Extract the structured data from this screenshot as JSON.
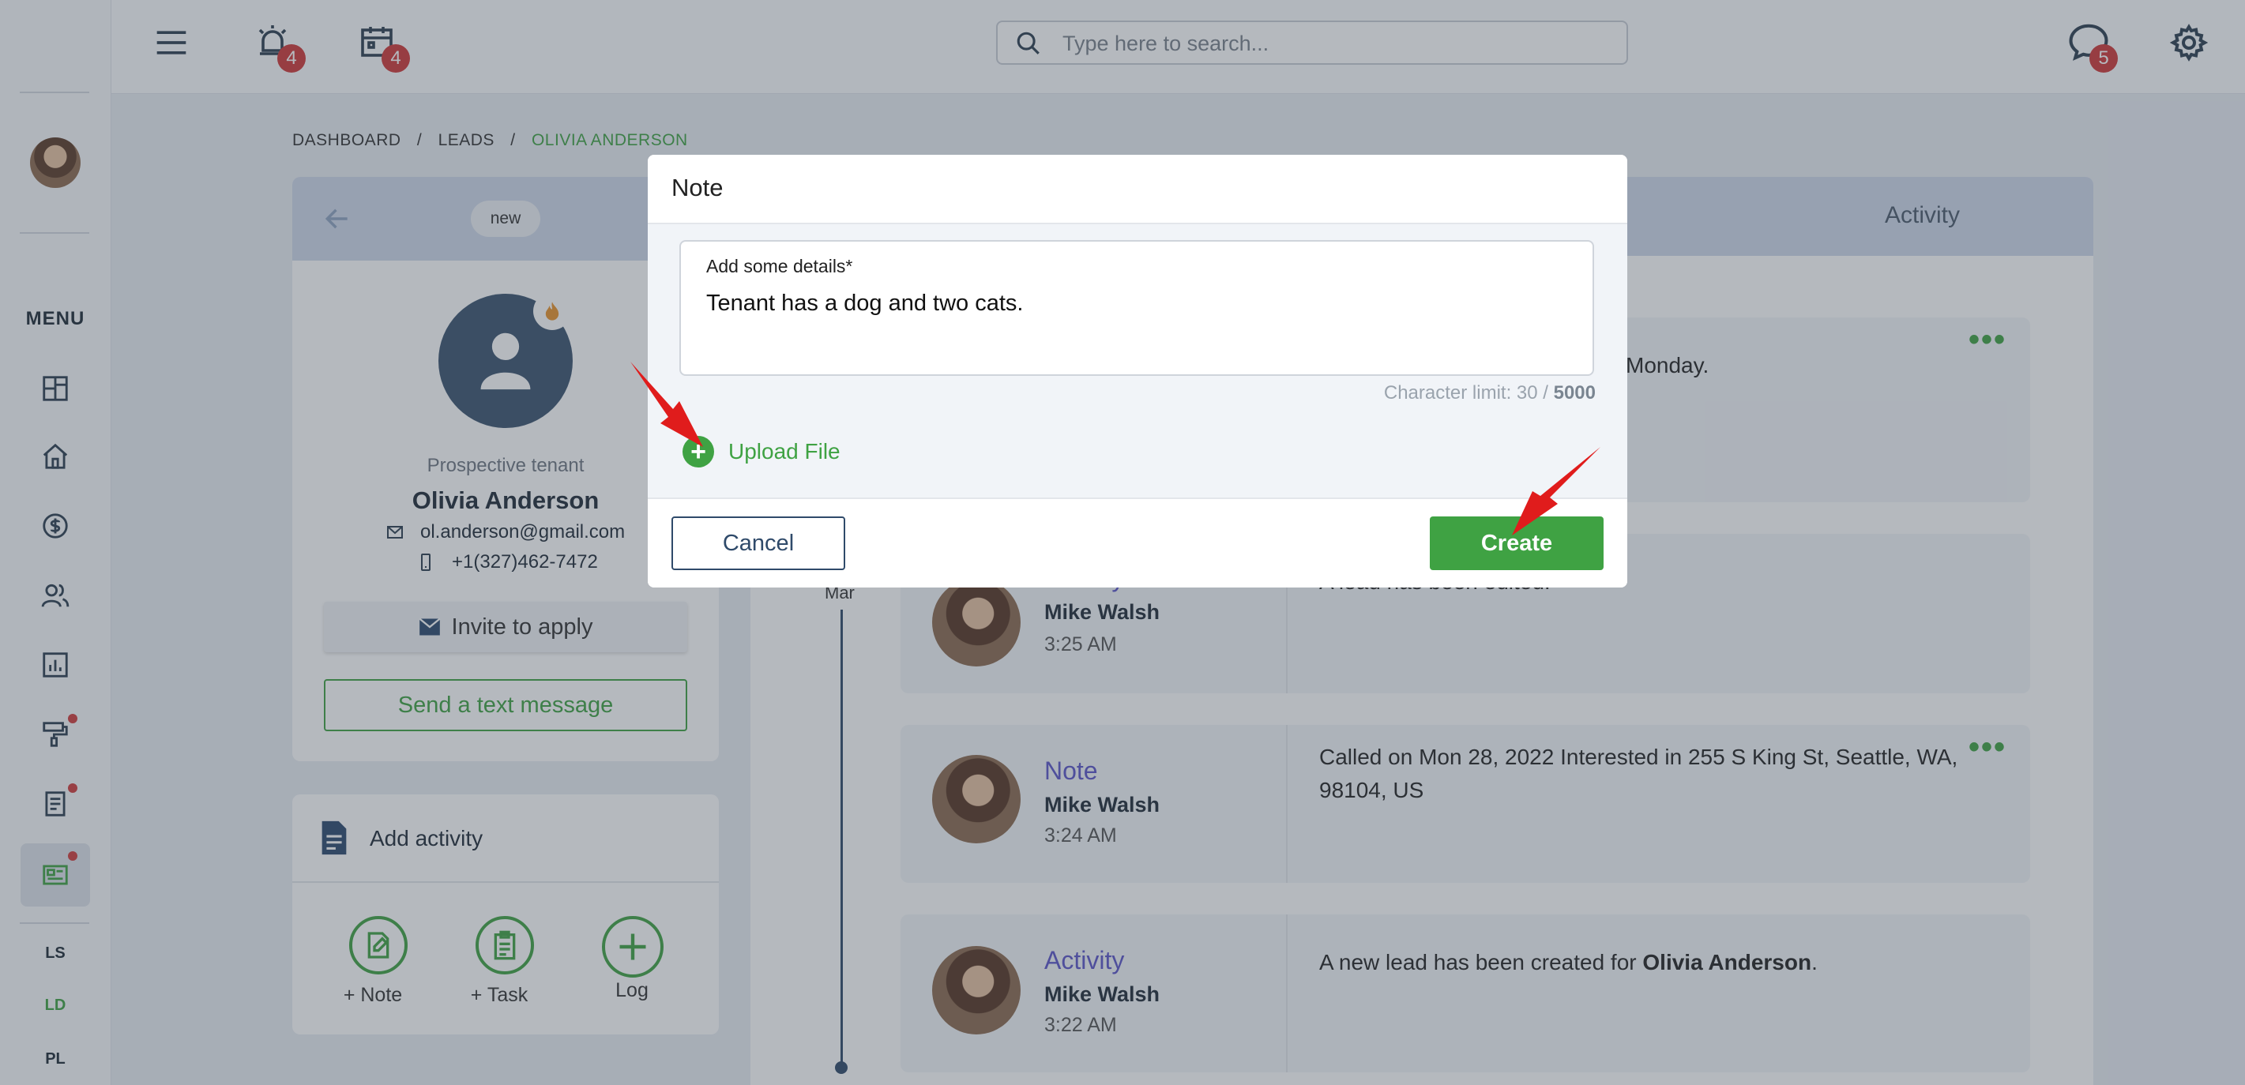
{
  "colors": {
    "accent": "#3fa243",
    "danger": "#cf3838",
    "primary_text": "#1f2a37",
    "link_purple": "#5b55c9"
  },
  "topbar": {
    "menu_icon": "hamburger-icon",
    "alarm_badge": "4",
    "calendar_badge": "4",
    "search_placeholder": "Type here to search...",
    "chat_badge": "5",
    "settings_icon": "gear-icon"
  },
  "sidebar": {
    "menu_label": "MENU",
    "icons": [
      "dashboard-icon",
      "home-icon",
      "dollar-icon",
      "users-icon",
      "chart-icon",
      "paint-roller-icon",
      "document-icon",
      "news-icon"
    ],
    "switch": [
      "LS",
      "LD",
      "PL"
    ]
  },
  "breadcrumb": [
    "DASHBOARD",
    "/",
    "LEADS",
    "/",
    "OLIVIA ANDERSON"
  ],
  "profile": {
    "status_pill": "new",
    "role": "Prospective tenant",
    "name": "Olivia Anderson",
    "email": "ol.anderson@gmail.com",
    "phone": "+1(327)462-7472",
    "invite_label": "Invite to apply",
    "text_label": "Send a text message"
  },
  "add_activity": {
    "title": "Add activity",
    "actions": [
      "+ Note",
      "+ Task",
      "Log"
    ]
  },
  "tabs": {
    "activity": "Activity"
  },
  "timeline": {
    "month": "Mar",
    "items": [
      {
        "text_fragment": "Monday."
      },
      {
        "type": "Activity",
        "author": "Mike Walsh",
        "time": "3:25 AM",
        "text": "A lead has been edited."
      },
      {
        "type": "Note",
        "author": "Mike Walsh",
        "time": "3:24 AM",
        "text": "Called on Mon 28, 2022 Interested in 255 S King St, Seattle, WA, 98104, US"
      },
      {
        "type": "Activity",
        "author": "Mike Walsh",
        "time": "3:22 AM",
        "text_pre": "A new lead has been created for ",
        "text_bold": "Olivia Anderson",
        "text_post": "."
      }
    ]
  },
  "modal": {
    "title": "Note",
    "field_label": "Add some details*",
    "field_value": "Tenant has a dog and two cats.",
    "char_limit_prefix": "Character limit: 30 / ",
    "char_limit_max": "5000",
    "upload_label": "Upload File",
    "cancel_label": "Cancel",
    "create_label": "Create"
  }
}
